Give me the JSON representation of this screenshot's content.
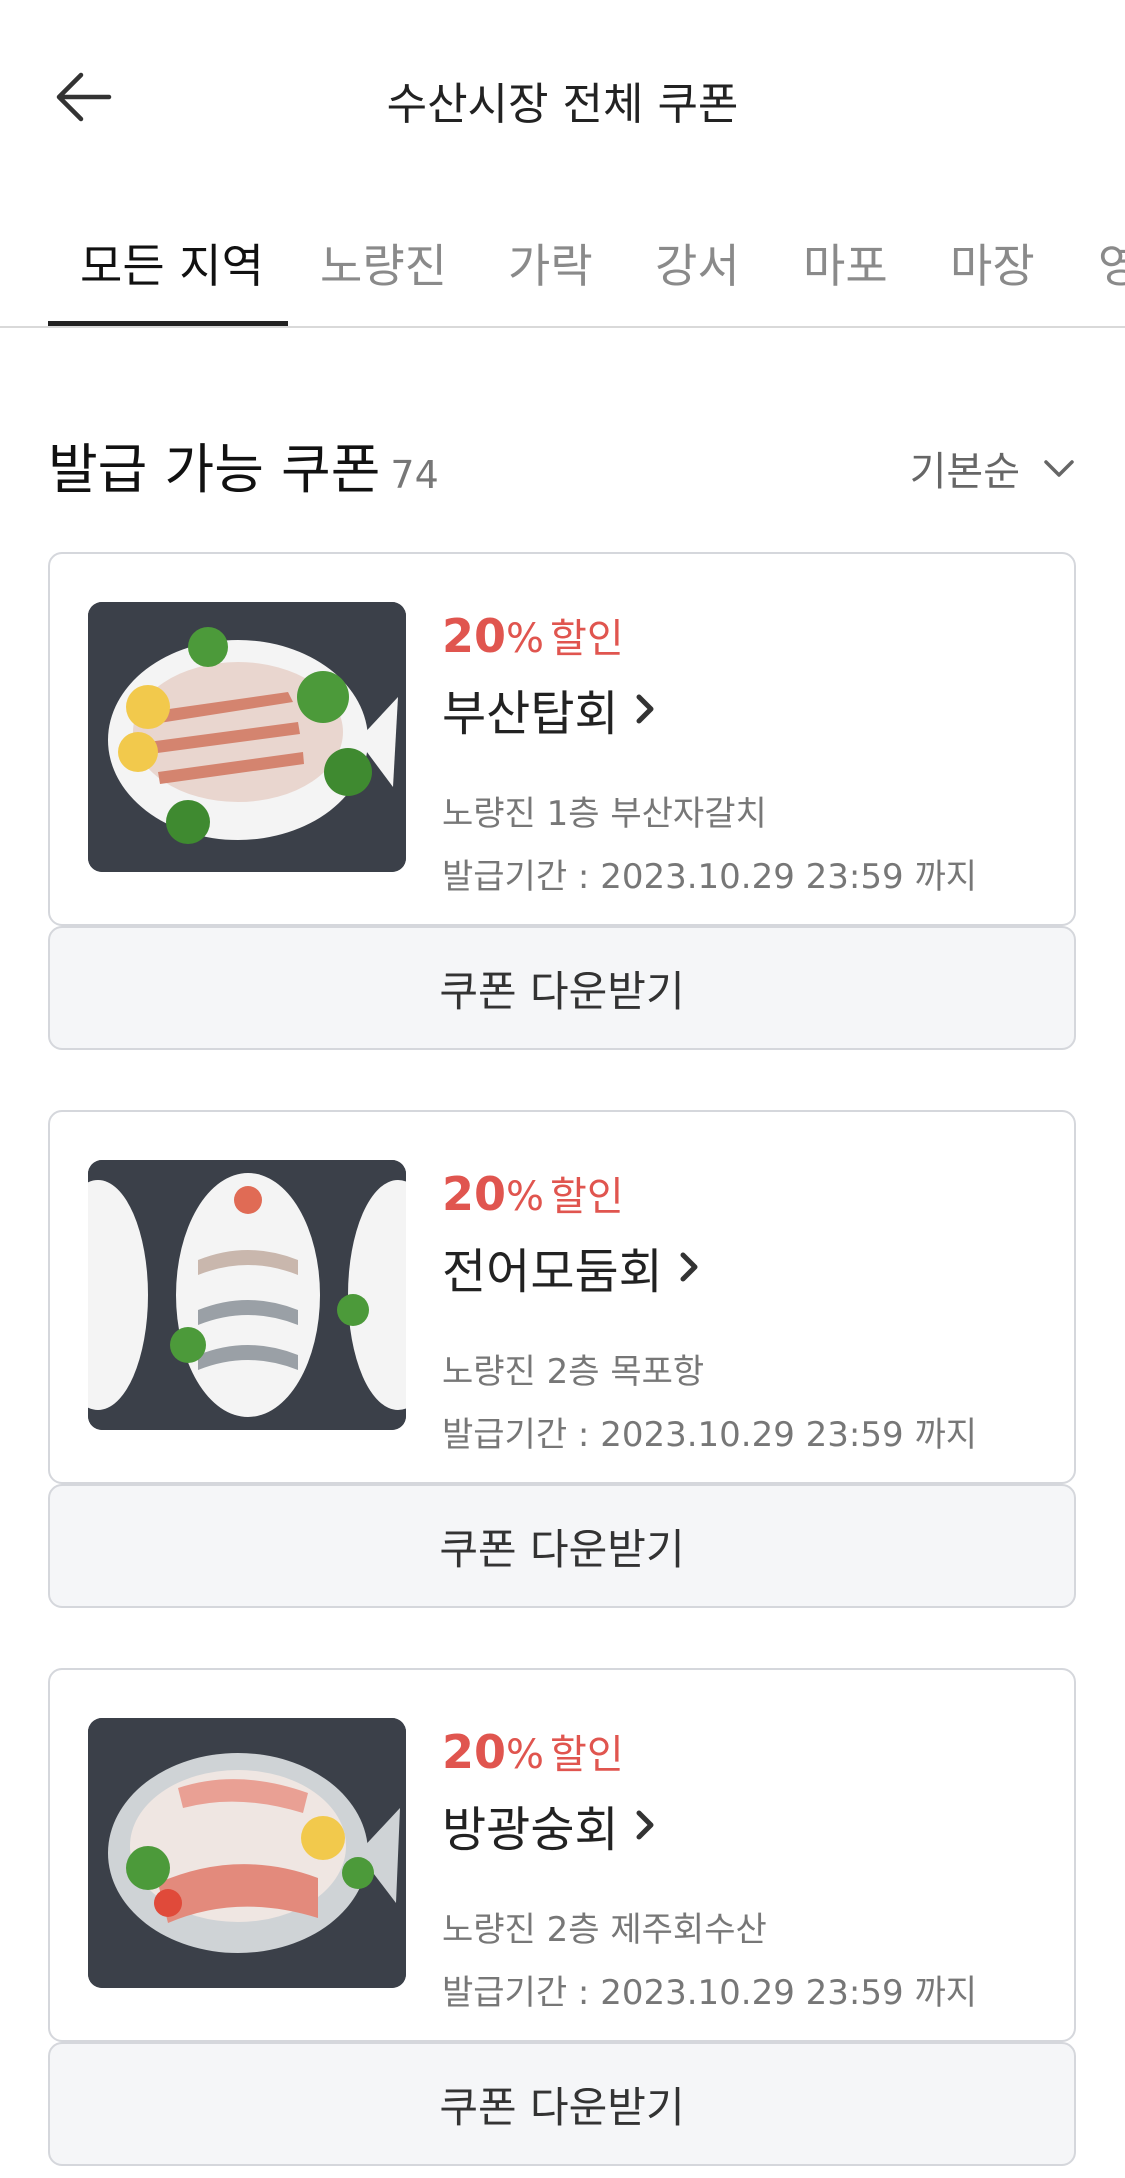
{
  "header": {
    "title": "수산시장 전체 쿠폰"
  },
  "tabs": [
    {
      "label": "모든 지역"
    },
    {
      "label": "노량진"
    },
    {
      "label": "가락"
    },
    {
      "label": "강서"
    },
    {
      "label": "마포"
    },
    {
      "label": "마장"
    },
    {
      "label": "영"
    }
  ],
  "section": {
    "title": "발급 가능 쿠폰",
    "count": "74",
    "sort_label": "기본순"
  },
  "coupons": [
    {
      "discount_value": "20",
      "discount_unit": "%",
      "discount_word": "할인",
      "store": "부산탑회",
      "location": "노량진 1층 부산자갈치",
      "period": "발급기간 : 2023.10.29 23:59 까지",
      "button": "쿠폰 다운받기"
    },
    {
      "discount_value": "20",
      "discount_unit": "%",
      "discount_word": "할인",
      "store": "전어모둠회",
      "location": "노량진 2층 목포항",
      "period": "발급기간 : 2023.10.29 23:59 까지",
      "button": "쿠폰 다운받기"
    },
    {
      "discount_value": "20",
      "discount_unit": "%",
      "discount_word": "할인",
      "store": "방광숭회",
      "location": "노량진 2층 제주회수산",
      "period": "발급기간 : 2023.10.29 23:59 까지",
      "button": "쿠폰 다운받기"
    }
  ],
  "colors": {
    "accent": "#e0554f",
    "border": "#d5d7dc",
    "button_bg": "#f5f6f8"
  },
  "icons": {
    "back": "arrow-left-icon",
    "sort": "chevron-down-icon",
    "store_link": "chevron-right-icon"
  }
}
